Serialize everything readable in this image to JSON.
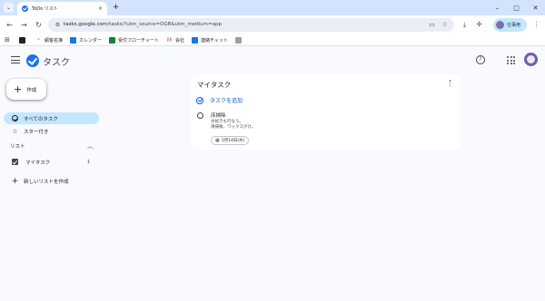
{
  "browser": {
    "tab_title": "ToDo リスト",
    "tab_close": "×",
    "new_tab": "+",
    "url_host": "tasks.google.com",
    "url_path": "/tasks/?utm_source=OGB&utm_medium=app",
    "profile_label": "仕事用",
    "window_controls": [
      "–",
      "□",
      "✕"
    ],
    "nav": {
      "back": "←",
      "forward": "→",
      "reload": "↻"
    }
  },
  "bookmarks": [
    {
      "label": "",
      "icon": "dark-square-icon",
      "color": "#202124"
    },
    {
      "label": "顧客名簿",
      "icon": "sparkle-icon",
      "color": "#a142f4"
    },
    {
      "label": "カレンダー",
      "icon": "calendar-icon",
      "color": "#1a73e8"
    },
    {
      "label": "受付フローチャート",
      "icon": "sheets-icon",
      "color": "#188038"
    },
    {
      "label": "会社",
      "icon": "gmail-icon",
      "color": "#ea4335"
    },
    {
      "label": "連絡チャット",
      "icon": "chat-icon",
      "color": "#1a73e8"
    },
    {
      "label": "",
      "icon": "image-icon",
      "color": "#5f6368"
    }
  ],
  "app": {
    "title": "タスク",
    "create_label": "作成",
    "nav_items": [
      {
        "label": "すべてのタスク",
        "active": true
      },
      {
        "label": "スター付き",
        "active": false
      }
    ],
    "lists_header": "リスト",
    "lists": [
      {
        "label": "マイタスク",
        "count": "1"
      }
    ],
    "new_list_label": "新しいリストを作成"
  },
  "card": {
    "title": "マイタスク",
    "add_task_label": "タスクを追加",
    "tasks": [
      {
        "title": "床掃除",
        "notes": [
          "水拭きも行なう。",
          "清掃後、ワックスがけ。"
        ],
        "date": "1月14日(水)"
      }
    ]
  },
  "colors": {
    "accent": "#0b57d0",
    "active_nav": "#c2e7ff",
    "tabstrip": "#d3e3fd",
    "logo": "#1a73e8"
  }
}
